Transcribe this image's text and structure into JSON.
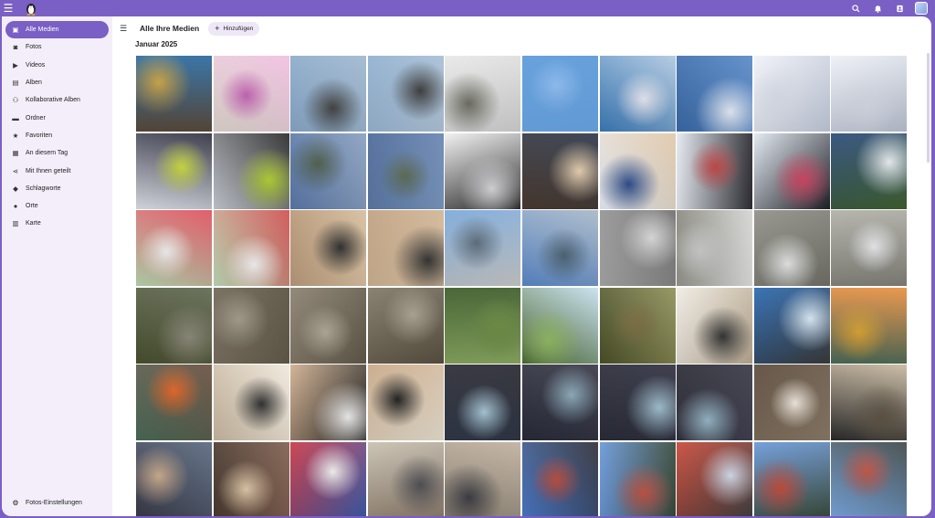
{
  "sidebar": {
    "items": [
      {
        "label": "Alle Medien",
        "icon": "photo-library-icon"
      },
      {
        "label": "Fotos",
        "icon": "camera-icon"
      },
      {
        "label": "Videos",
        "icon": "video-icon"
      },
      {
        "label": "Alben",
        "icon": "album-icon"
      },
      {
        "label": "Kollaborative Alben",
        "icon": "collab-album-icon"
      },
      {
        "label": "Ordner",
        "icon": "folder-icon"
      },
      {
        "label": "Favoriten",
        "icon": "star-icon"
      },
      {
        "label": "An diesem Tag",
        "icon": "calendar-icon"
      },
      {
        "label": "Mit Ihnen geteilt",
        "icon": "share-icon"
      },
      {
        "label": "Schlagworte",
        "icon": "tag-icon"
      },
      {
        "label": "Orte",
        "icon": "pin-icon"
      },
      {
        "label": "Karte",
        "icon": "map-icon"
      }
    ],
    "settings_label": "Fotos-Einstellungen"
  },
  "header": {
    "title": "Alle Ihre Medien",
    "add_label": "Hinzufügen"
  },
  "section": {
    "title": "Januar 2025"
  },
  "colors": {
    "accent": "#7a5fc4",
    "sidebar_bg": "#f3eef9"
  },
  "photos": [
    "crowd-santa",
    "pink-orchid",
    "city-ring-sculpture",
    "city-ring-sculpture-2",
    "backpack-on-snow",
    "moon-blue-sky",
    "ski-map",
    "mount-fuji-screenshot",
    "skier-slope",
    "skier-slope-2",
    "skier-yellow-jacket",
    "skier-green-jacket",
    "mountain-valley",
    "mountain-valley-2",
    "skier-fallen-snow",
    "person-eating",
    "person-eating-2",
    "skiers-legs",
    "skiers-legs-2",
    "ski-resort-sign",
    "map-screenshot",
    "map-screenshot-2",
    "calligraphy-stats",
    "calligraphy-stats-2",
    "shibuya-buildings",
    "shibuya-buildings-2",
    "frosty-leaves",
    "frosty-rock",
    "frost-ground",
    "frost-ground-2",
    "rocky-stream",
    "rock-wall",
    "rock-wall-2",
    "rock-wall-3",
    "forest-ferns",
    "forest-trees",
    "forest-floor",
    "calligraphy-paper",
    "blue-stationery",
    "persimmon-branch",
    "persimmon-table",
    "calligraphy-character",
    "calligraphy-frame",
    "calligraphy-frame-2",
    "person-fleece",
    "person-fleece-2",
    "person-fleece-3",
    "person-fleece-4",
    "desk-work",
    "family-gathering",
    "person-table",
    "family-dinner",
    "red-app-screenshot",
    "temple-visit",
    "family-photo",
    "shrine-crowd",
    "shrine-gate",
    "shrine-gate-2",
    "shrine-crowd-2",
    "shrine-crowd-3"
  ]
}
